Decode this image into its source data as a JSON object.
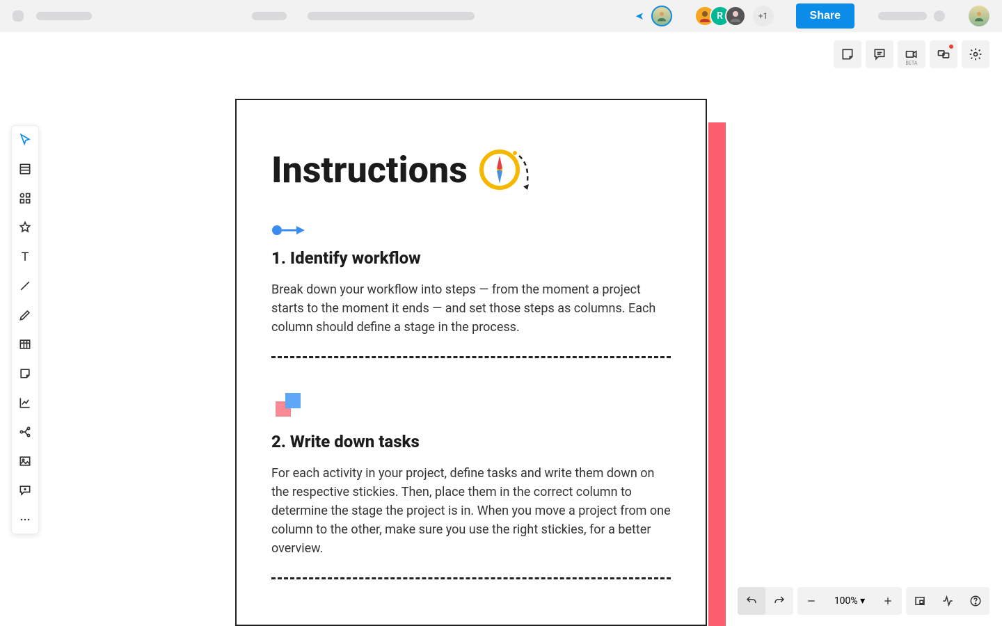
{
  "topbar": {
    "share_label": "Share",
    "plus_one": "+1",
    "avatars": [
      "p1",
      "p2",
      "p3",
      "p4"
    ],
    "avatar3_initial": "R"
  },
  "right_toolbar": {
    "beta_label": "BETA"
  },
  "canvas": {
    "title": "Instructions",
    "sections": [
      {
        "heading": "1. Identify workflow",
        "body": "Break down your workflow into steps — from the moment a project starts to the moment it ends — and set those steps as columns. Each column should define a stage in the process."
      },
      {
        "heading": "2. Write down tasks",
        "body": "For each activity in your project, define tasks and write them down on the respective stickies. Then, place them in the correct column to determine the stage the project is in. When you move a project from one column to the other, make sure you use the right stickies, for a better overview."
      }
    ]
  },
  "bottom": {
    "zoom": "100%"
  }
}
